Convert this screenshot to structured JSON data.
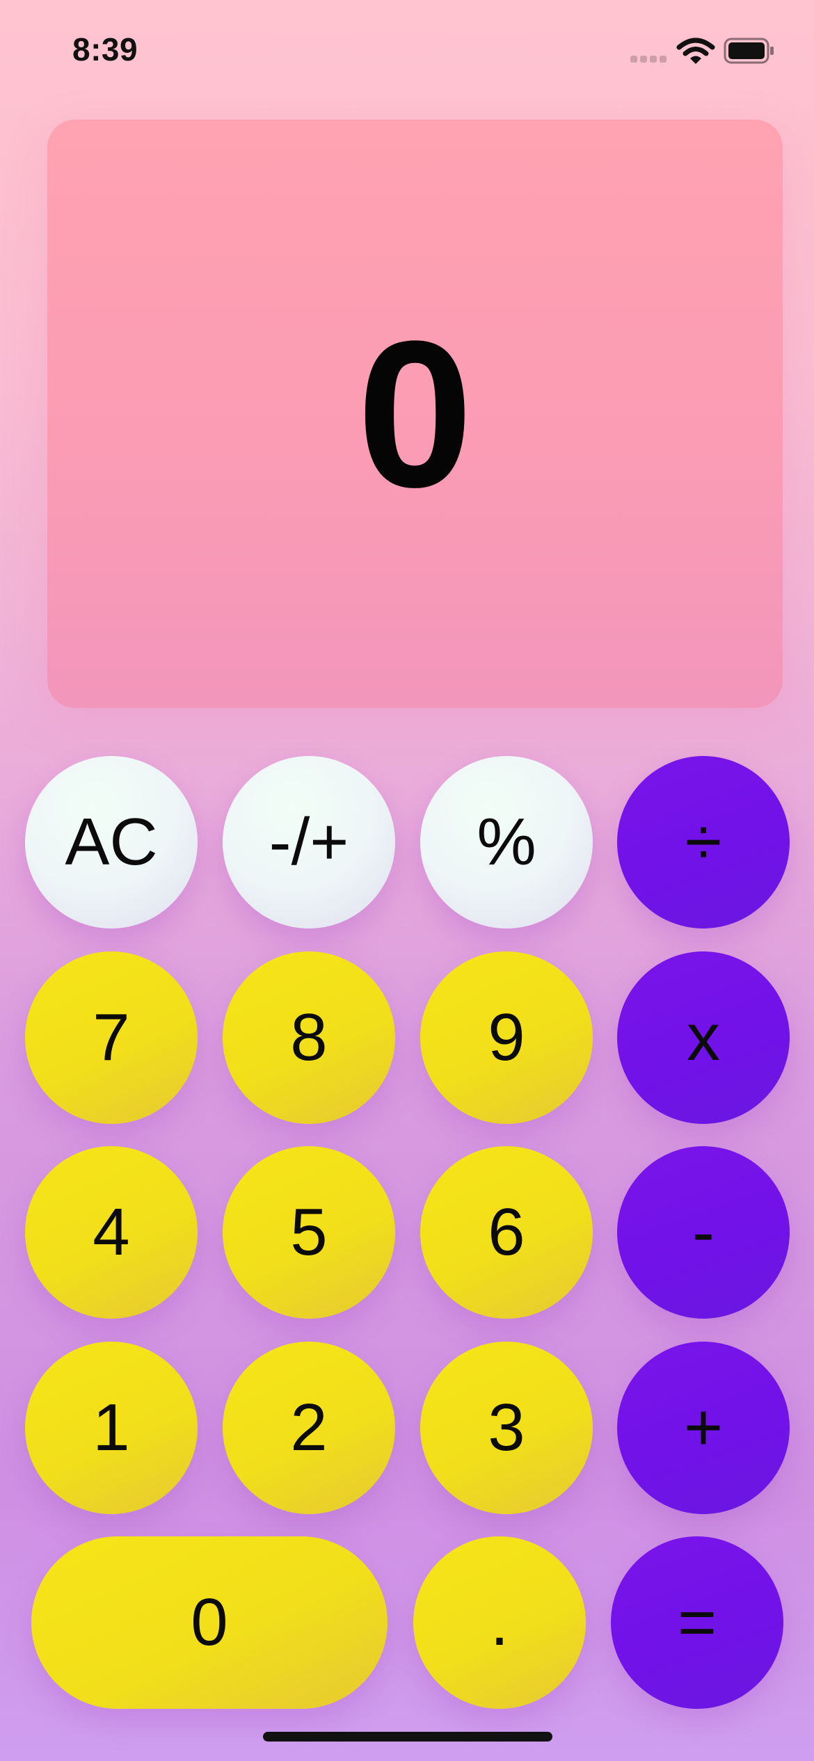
{
  "status_bar": {
    "time": "8:39"
  },
  "display": {
    "value": "0"
  },
  "keypad": {
    "row1": [
      "AC",
      "-/+",
      "%",
      "÷"
    ],
    "row2": [
      "7",
      "8",
      "9",
      "x"
    ],
    "row3": [
      "4",
      "5",
      "6",
      "-"
    ],
    "row4": [
      "1",
      "2",
      "3",
      "+"
    ],
    "row5": [
      "0",
      ".",
      "="
    ]
  },
  "colors": {
    "display_bg": "#fb9cb4",
    "function_key": "#eef6f7",
    "number_key": "#f2df1a",
    "operator_key": "#7012e8"
  }
}
